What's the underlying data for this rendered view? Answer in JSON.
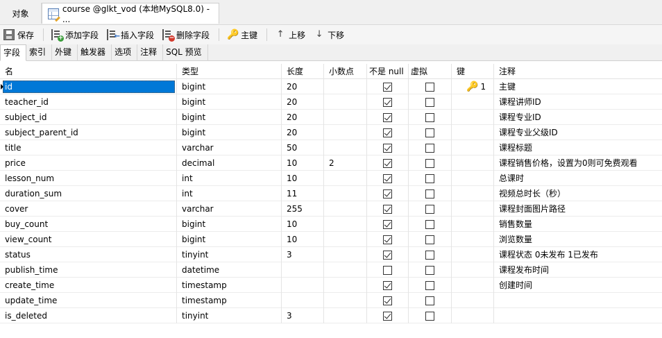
{
  "doc_tabs": {
    "objects_label": "对象",
    "active_label": "course @glkt_vod (本地MySQL8.0) - ..."
  },
  "toolbar": {
    "save": "保存",
    "add_field": "添加字段",
    "insert_field": "插入字段",
    "delete_field": "删除字段",
    "primary_key": "主键",
    "move_up": "上移",
    "move_down": "下移"
  },
  "sub_tabs": [
    "字段",
    "索引",
    "外键",
    "触发器",
    "选项",
    "注释",
    "SQL 预览"
  ],
  "columns": {
    "name": "名",
    "type": "类型",
    "length": "长度",
    "decimals": "小数点",
    "not_null": "不是 null",
    "virtual": "虚拟",
    "key": "键",
    "comment": "注释"
  },
  "rows": [
    {
      "name": "id",
      "type": "bigint",
      "length": "20",
      "decimals": "",
      "not_null": true,
      "virtual": false,
      "key": "1",
      "comment": "主键"
    },
    {
      "name": "teacher_id",
      "type": "bigint",
      "length": "20",
      "decimals": "",
      "not_null": true,
      "virtual": false,
      "key": "",
      "comment": "课程讲师ID"
    },
    {
      "name": "subject_id",
      "type": "bigint",
      "length": "20",
      "decimals": "",
      "not_null": true,
      "virtual": false,
      "key": "",
      "comment": "课程专业ID"
    },
    {
      "name": "subject_parent_id",
      "type": "bigint",
      "length": "20",
      "decimals": "",
      "not_null": true,
      "virtual": false,
      "key": "",
      "comment": "课程专业父级ID"
    },
    {
      "name": "title",
      "type": "varchar",
      "length": "50",
      "decimals": "",
      "not_null": true,
      "virtual": false,
      "key": "",
      "comment": "课程标题"
    },
    {
      "name": "price",
      "type": "decimal",
      "length": "10",
      "decimals": "2",
      "not_null": true,
      "virtual": false,
      "key": "",
      "comment": "课程销售价格，设置为0则可免费观看"
    },
    {
      "name": "lesson_num",
      "type": "int",
      "length": "10",
      "decimals": "",
      "not_null": true,
      "virtual": false,
      "key": "",
      "comment": "总课时"
    },
    {
      "name": "duration_sum",
      "type": "int",
      "length": "11",
      "decimals": "",
      "not_null": true,
      "virtual": false,
      "key": "",
      "comment": "视频总时长（秒）"
    },
    {
      "name": "cover",
      "type": "varchar",
      "length": "255",
      "decimals": "",
      "not_null": true,
      "virtual": false,
      "key": "",
      "comment": "课程封面图片路径"
    },
    {
      "name": "buy_count",
      "type": "bigint",
      "length": "10",
      "decimals": "",
      "not_null": true,
      "virtual": false,
      "key": "",
      "comment": "销售数量"
    },
    {
      "name": "view_count",
      "type": "bigint",
      "length": "10",
      "decimals": "",
      "not_null": true,
      "virtual": false,
      "key": "",
      "comment": "浏览数量"
    },
    {
      "name": "status",
      "type": "tinyint",
      "length": "3",
      "decimals": "",
      "not_null": true,
      "virtual": false,
      "key": "",
      "comment": "课程状态 0未发布 1已发布"
    },
    {
      "name": "publish_time",
      "type": "datetime",
      "length": "",
      "decimals": "",
      "not_null": false,
      "virtual": false,
      "key": "",
      "comment": "课程发布时间"
    },
    {
      "name": "create_time",
      "type": "timestamp",
      "length": "",
      "decimals": "",
      "not_null": true,
      "virtual": false,
      "key": "",
      "comment": "创建时间"
    },
    {
      "name": "update_time",
      "type": "timestamp",
      "length": "",
      "decimals": "",
      "not_null": true,
      "virtual": false,
      "key": "",
      "comment": ""
    },
    {
      "name": "is_deleted",
      "type": "tinyint",
      "length": "3",
      "decimals": "",
      "not_null": true,
      "virtual": false,
      "key": "",
      "comment": ""
    }
  ]
}
